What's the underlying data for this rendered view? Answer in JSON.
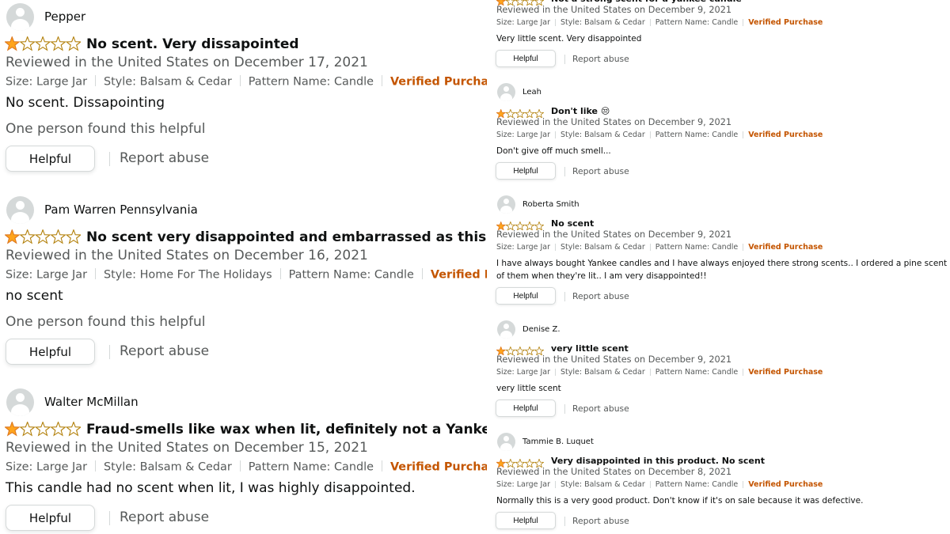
{
  "ui": {
    "helpful_label": "Helpful",
    "report_label": "Report abuse",
    "verified_label": "Verified Purchase",
    "star_color": "#ffa41c",
    "verified_color": "#c45500",
    "muted_color": "#565959"
  },
  "left_reviews": [
    {
      "name": "Pepper",
      "rating": 1,
      "title": "No scent. Very dissapointed",
      "date": "Reviewed in the United States on December 17, 2021",
      "size": "Size: Large Jar",
      "style": "Style: Balsam & Cedar",
      "pattern": "Pattern Name: Candle",
      "body": "No scent. Dissapointing",
      "helpful": "One person found this helpful"
    },
    {
      "name": "Pam Warren Pennsylvania",
      "rating": 1,
      "title": "No scent very disappointed and embarrassed as this was a gift",
      "date": "Reviewed in the United States on December 16, 2021",
      "size": "Size: Large Jar",
      "style": "Style: Home For The Holidays",
      "pattern": "Pattern Name: Candle",
      "body": "no scent",
      "helpful": "One person found this helpful"
    },
    {
      "name": "Walter McMillan",
      "rating": 1,
      "title": "Fraud-smells like wax when lit, definitely not a Yankee.",
      "date": "Reviewed in the United States on December 15, 2021",
      "size": "Size: Large Jar",
      "style": "Style: Balsam & Cedar",
      "pattern": "Pattern Name: Candle",
      "body": "This candle had no scent when lit, I was highly disappointed.",
      "helpful": ""
    }
  ],
  "right_reviews": [
    {
      "name": "",
      "rating": 1,
      "title": "Not a strong scent for a yankee candle",
      "date": "Reviewed in the United States on December 9, 2021",
      "size": "Size: Large Jar",
      "style": "Style: Balsam & Cedar",
      "pattern": "Pattern Name: Candle",
      "body": [
        "Very little scent. Very disappointed"
      ]
    },
    {
      "name": "Leah",
      "rating": 1,
      "title": "Don't like 😒",
      "date": "Reviewed in the United States on December 9, 2021",
      "size": "Size: Large Jar",
      "style": "Style: Balsam & Cedar",
      "pattern": "Pattern Name: Candle",
      "body": [
        "Don't give off much smell..."
      ]
    },
    {
      "name": "Roberta Smith",
      "rating": 1,
      "title": "No scent",
      "date": "Reviewed in the United States on December 9, 2021",
      "size": "Size: Large Jar",
      "style": "Style: Balsam & Cedar",
      "pattern": "Pattern Name: Candle",
      "body": [
        "I have always bought Yankee candles and I have always enjoyed there strong scents.. I ordered a pine scent and a coo",
        "of them when they're lit.. I am very disappointed!!"
      ]
    },
    {
      "name": "Denise Z.",
      "rating": 1,
      "title": "very little scent",
      "date": "Reviewed in the United States on December 9, 2021",
      "size": "Size: Large Jar",
      "style": "Style: Balsam & Cedar",
      "pattern": "Pattern Name: Candle",
      "body": [
        "very little scent"
      ]
    },
    {
      "name": "Tammie B. Luquet",
      "rating": 1,
      "title": "Very disappointed in this product. No scent",
      "date": "Reviewed in the United States on December 8, 2021",
      "size": "Size: Large Jar",
      "style": "Style: Balsam & Cedar",
      "pattern": "Pattern Name: Candle",
      "body": [
        "Normally this is a very good product. Don't know if it's on sale because it was defective."
      ]
    }
  ]
}
